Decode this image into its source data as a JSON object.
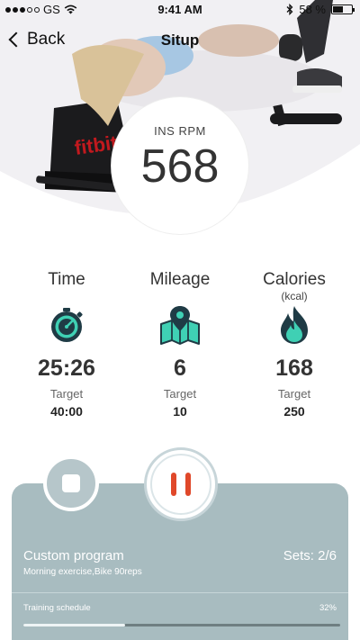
{
  "status_bar": {
    "carrier": "GS",
    "time": "9:41 AM",
    "battery": "58 %",
    "battery_level": 0.58
  },
  "nav": {
    "back_label": "Back",
    "title": "Situp"
  },
  "hero": {
    "rpm_label": "INS RPM",
    "rpm_value": "568",
    "equipment_brand": "fitbit"
  },
  "stats": [
    {
      "title": "Time",
      "unit": "",
      "icon": "stopwatch-icon",
      "value": "25:26",
      "target_label": "Target",
      "target": "40:00"
    },
    {
      "title": "Mileage",
      "unit": "",
      "icon": "map-pin-icon",
      "value": "6",
      "target_label": "Target",
      "target": "10"
    },
    {
      "title": "Calories",
      "unit": "(kcal)",
      "icon": "flame-icon",
      "value": "168",
      "target_label": "Target",
      "target": "250"
    }
  ],
  "controls": {
    "stop_icon": "stop-icon",
    "pause_icon": "pause-icon"
  },
  "program": {
    "name": "Custom program",
    "description": "Morning exercise,Bike 90reps",
    "sets": "Sets: 2/6",
    "schedule_label": "Training schedule",
    "schedule_percent": "32%",
    "progress": 0.32
  },
  "colors": {
    "accent": "#e0482a",
    "icon_teal": "#3fd0b4",
    "icon_dark": "#1f3b45",
    "panel": "#a8bcc0"
  }
}
